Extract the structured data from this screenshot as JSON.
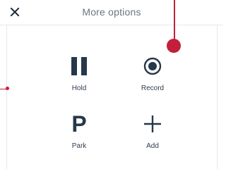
{
  "header": {
    "title": "More options",
    "close_icon": "close-icon"
  },
  "options": [
    {
      "label": "Hold",
      "icon": "pause-icon"
    },
    {
      "label": "Record",
      "icon": "record-icon"
    },
    {
      "label": "Park",
      "icon": "park-icon",
      "glyph": "P"
    },
    {
      "label": "Add",
      "icon": "plus-icon"
    }
  ],
  "colors": {
    "text": "#2f3e4e",
    "title": "#6b7480",
    "icon": "#26384a",
    "accent": "#c41f3a",
    "divider": "#e6e8eb"
  }
}
